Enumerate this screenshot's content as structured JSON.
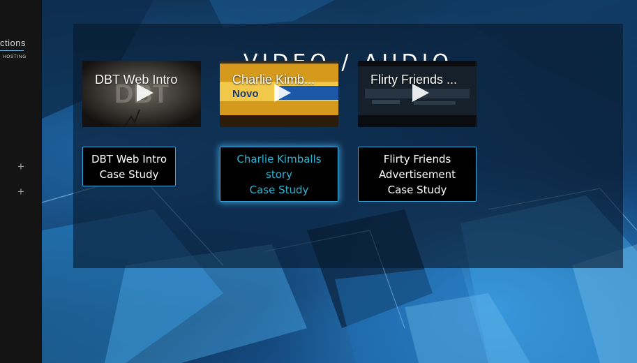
{
  "sidebar": {
    "logo_text": "ctions",
    "logo_subtitle": "HOSTING",
    "expand_symbol": "+"
  },
  "section": {
    "title": "VIDEO / AUDIO"
  },
  "videos": [
    {
      "title": "DBT Web Intro",
      "play_icon": "play-icon"
    },
    {
      "title": "Charlie Kimb...",
      "play_icon": "play-icon"
    },
    {
      "title": "Flirty Friends ...",
      "play_icon": "play-icon"
    }
  ],
  "case_studies": [
    {
      "lines": [
        "DBT Web Intro",
        "Case Study"
      ],
      "active": false
    },
    {
      "lines": [
        "Charlie Kimballs",
        "story",
        "Case Study"
      ],
      "active": true
    },
    {
      "lines": [
        "Flirty Friends",
        "Advertisement",
        "Case Study"
      ],
      "active": false
    }
  ],
  "colors": {
    "accent": "#3aa6d8",
    "active_text": "#2bb6d6",
    "panel_bg": "#08182c",
    "sidebar_bg": "#141414"
  }
}
